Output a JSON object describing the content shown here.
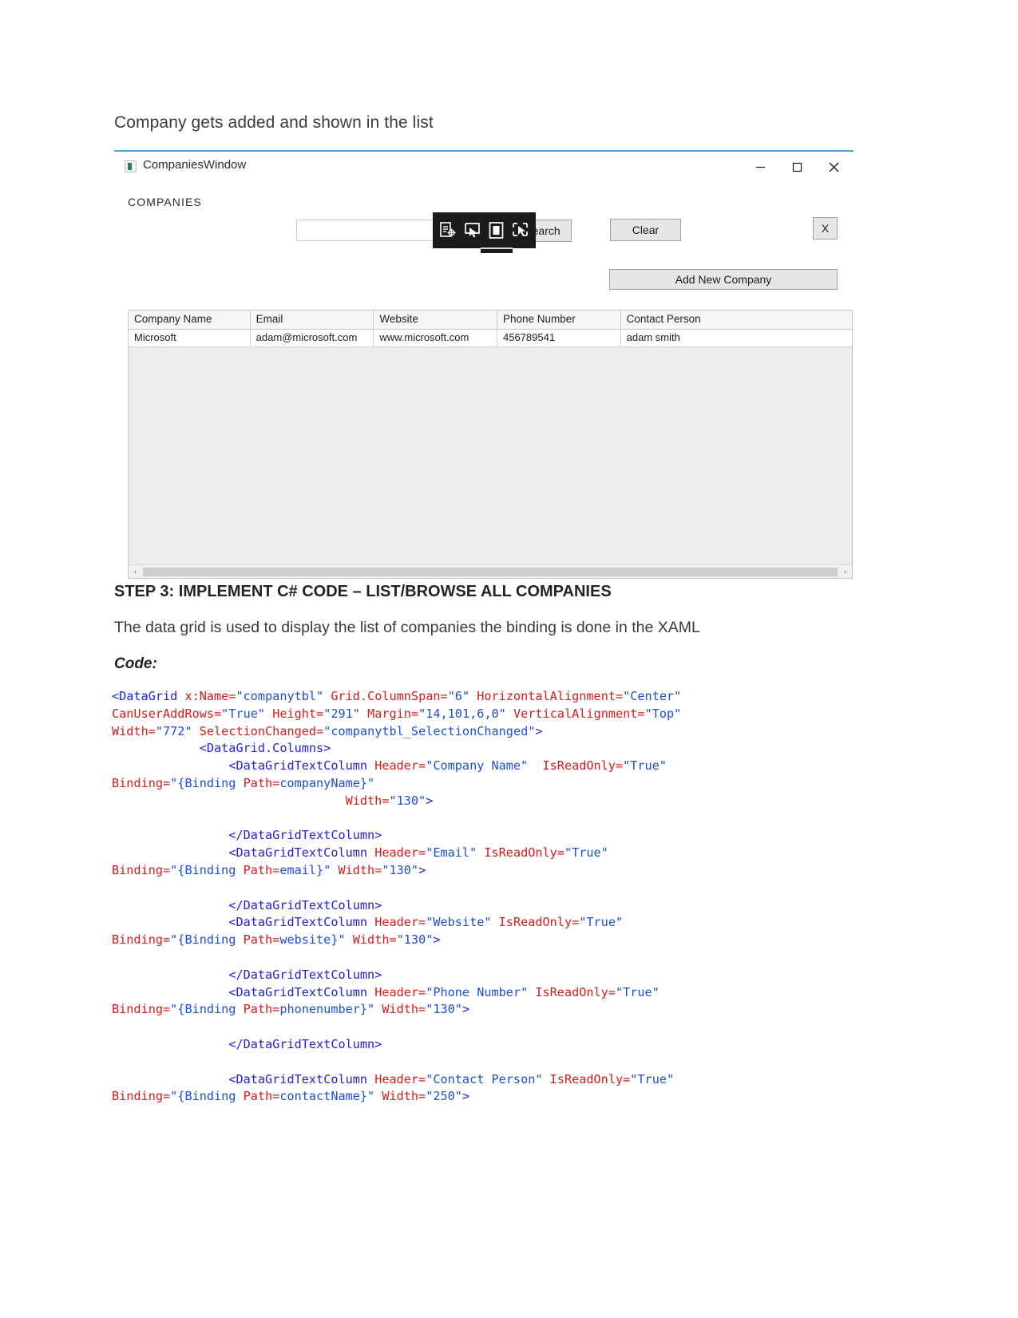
{
  "document": {
    "caption": "Company gets added and shown in the list",
    "step_heading": "STEP 3: IMPLEMENT C# CODE – LIST/BROWSE ALL COMPANIES",
    "description": "The data grid is used to display the list of companies the binding is done in the XAML",
    "code_label": "Code:"
  },
  "app_window": {
    "title": "CompaniesWindow",
    "icon": "app-window-icon",
    "window_controls": {
      "minimize": "minimize-icon",
      "maximize": "maximize-icon",
      "close": "close-icon"
    },
    "section_label": "COMPANIES",
    "search_input": {
      "value": "",
      "placeholder": ""
    },
    "buttons": {
      "search": "Search",
      "clear": "Clear",
      "close_x": "X",
      "add_new_company": "Add New Company"
    },
    "snip_toolbar": {
      "icons": [
        "window-snip-icon",
        "cursor-snip-icon",
        "rectangle-snip-icon",
        "freeform-snip-icon"
      ]
    },
    "datagrid": {
      "columns": [
        "Company Name",
        "Email",
        "Website",
        "Phone Number",
        "Contact Person"
      ],
      "rows": [
        [
          "Microsoft",
          "adam@microsoft.com",
          "www.microsoft.com",
          "456789541",
          "adam smith"
        ]
      ],
      "hscrollbar": {
        "left_arrow": "‹",
        "right_arrow": "›"
      }
    }
  },
  "code": {
    "lines": [
      [
        [
          "tag",
          "<DataGrid "
        ],
        [
          "attr",
          "x:Name="
        ],
        [
          "val",
          "\"companytbl\""
        ],
        [
          "plain",
          " "
        ],
        [
          "attr",
          "Grid.ColumnSpan="
        ],
        [
          "val",
          "\"6\""
        ],
        [
          "plain",
          " "
        ],
        [
          "attr",
          "HorizontalAlignment="
        ],
        [
          "val",
          "\"Center\""
        ]
      ],
      [
        [
          "attr",
          "CanUserAddRows="
        ],
        [
          "val",
          "\"True\""
        ],
        [
          "plain",
          " "
        ],
        [
          "attr",
          "Height="
        ],
        [
          "val",
          "\"291\""
        ],
        [
          "plain",
          " "
        ],
        [
          "attr",
          "Margin="
        ],
        [
          "val",
          "\"14,101,6,0\""
        ],
        [
          "plain",
          " "
        ],
        [
          "attr",
          "VerticalAlignment="
        ],
        [
          "val",
          "\"Top\""
        ]
      ],
      [
        [
          "attr",
          "Width="
        ],
        [
          "val",
          "\"772\""
        ],
        [
          "plain",
          " "
        ],
        [
          "attr",
          "SelectionChanged="
        ],
        [
          "val",
          "\"companytbl_SelectionChanged\""
        ],
        [
          "tag",
          ">"
        ]
      ],
      [
        [
          "plain",
          "            "
        ],
        [
          "tag",
          "<DataGrid.Columns>"
        ]
      ],
      [
        [
          "plain",
          "                "
        ],
        [
          "tag",
          "<DataGridTextColumn "
        ],
        [
          "attr",
          "Header="
        ],
        [
          "val",
          "\"Company Name\""
        ],
        [
          "plain",
          "  "
        ],
        [
          "attr",
          "IsReadOnly="
        ],
        [
          "val",
          "\"True\""
        ]
      ],
      [
        [
          "attr",
          "Binding="
        ],
        [
          "val",
          "\"{Binding "
        ],
        [
          "attr",
          "Path="
        ],
        [
          "val",
          "companyName}\""
        ]
      ],
      [
        [
          "plain",
          "                                "
        ],
        [
          "attr",
          "Width="
        ],
        [
          "val",
          "\"130\""
        ],
        [
          "tag",
          ">"
        ]
      ],
      [
        [
          "plain",
          ""
        ]
      ],
      [
        [
          "plain",
          "                "
        ],
        [
          "tag",
          "</DataGridTextColumn>"
        ]
      ],
      [
        [
          "plain",
          "                "
        ],
        [
          "tag",
          "<DataGridTextColumn "
        ],
        [
          "attr",
          "Header="
        ],
        [
          "val",
          "\"Email\""
        ],
        [
          "plain",
          " "
        ],
        [
          "attr",
          "IsReadOnly="
        ],
        [
          "val",
          "\"True\""
        ]
      ],
      [
        [
          "attr",
          "Binding="
        ],
        [
          "val",
          "\"{Binding "
        ],
        [
          "attr",
          "Path="
        ],
        [
          "val",
          "email}\""
        ],
        [
          "plain",
          " "
        ],
        [
          "attr",
          "Width="
        ],
        [
          "val",
          "\"130\""
        ],
        [
          "tag",
          ">"
        ]
      ],
      [
        [
          "plain",
          ""
        ]
      ],
      [
        [
          "plain",
          "                "
        ],
        [
          "tag",
          "</DataGridTextColumn>"
        ]
      ],
      [
        [
          "plain",
          "                "
        ],
        [
          "tag",
          "<DataGridTextColumn "
        ],
        [
          "attr",
          "Header="
        ],
        [
          "val",
          "\"Website\""
        ],
        [
          "plain",
          " "
        ],
        [
          "attr",
          "IsReadOnly="
        ],
        [
          "val",
          "\"True\""
        ]
      ],
      [
        [
          "attr",
          "Binding="
        ],
        [
          "val",
          "\"{Binding "
        ],
        [
          "attr",
          "Path="
        ],
        [
          "val",
          "website}\""
        ],
        [
          "plain",
          " "
        ],
        [
          "attr",
          "Width="
        ],
        [
          "val",
          "\"130\""
        ],
        [
          "tag",
          ">"
        ]
      ],
      [
        [
          "plain",
          ""
        ]
      ],
      [
        [
          "plain",
          "                "
        ],
        [
          "tag",
          "</DataGridTextColumn>"
        ]
      ],
      [
        [
          "plain",
          "                "
        ],
        [
          "tag",
          "<DataGridTextColumn "
        ],
        [
          "attr",
          "Header="
        ],
        [
          "val",
          "\"Phone Number\""
        ],
        [
          "plain",
          " "
        ],
        [
          "attr",
          "IsReadOnly="
        ],
        [
          "val",
          "\"True\""
        ]
      ],
      [
        [
          "attr",
          "Binding="
        ],
        [
          "val",
          "\"{Binding "
        ],
        [
          "attr",
          "Path="
        ],
        [
          "val",
          "phonenumber}\""
        ],
        [
          "plain",
          " "
        ],
        [
          "attr",
          "Width="
        ],
        [
          "val",
          "\"130\""
        ],
        [
          "tag",
          ">"
        ]
      ],
      [
        [
          "plain",
          ""
        ]
      ],
      [
        [
          "plain",
          "                "
        ],
        [
          "tag",
          "</DataGridTextColumn>"
        ]
      ],
      [
        [
          "plain",
          ""
        ]
      ],
      [
        [
          "plain",
          "                "
        ],
        [
          "tag",
          "<DataGridTextColumn "
        ],
        [
          "attr",
          "Header="
        ],
        [
          "val",
          "\"Contact Person\""
        ],
        [
          "plain",
          " "
        ],
        [
          "attr",
          "IsReadOnly="
        ],
        [
          "val",
          "\"True\""
        ]
      ],
      [
        [
          "attr",
          "Binding="
        ],
        [
          "val",
          "\"{Binding "
        ],
        [
          "attr",
          "Path="
        ],
        [
          "val",
          "contactName}\""
        ],
        [
          "plain",
          " "
        ],
        [
          "attr",
          "Width="
        ],
        [
          "val",
          "\"250\""
        ],
        [
          "tag",
          ">"
        ]
      ]
    ]
  }
}
